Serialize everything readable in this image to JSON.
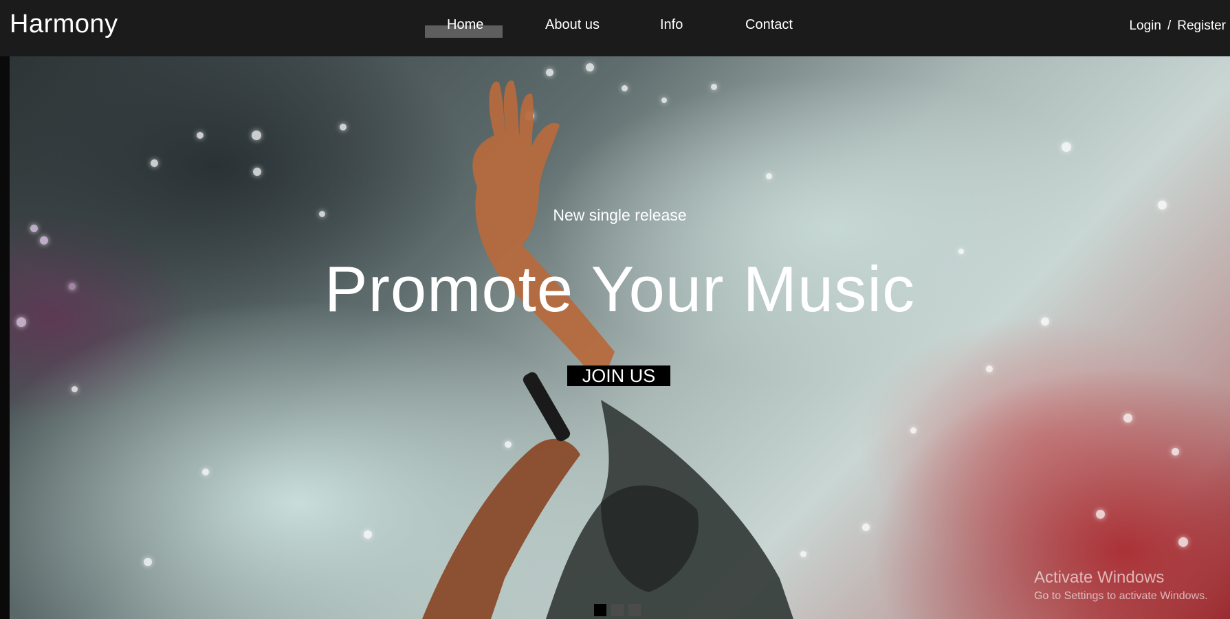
{
  "header": {
    "logo": "Harmony",
    "nav": {
      "items": [
        {
          "label": "Home",
          "active": true
        },
        {
          "label": "About us",
          "active": false
        },
        {
          "label": "Info",
          "active": false
        },
        {
          "label": "Contact",
          "active": false
        }
      ]
    },
    "auth": {
      "login": "Login",
      "separator": "/",
      "register": "Register"
    }
  },
  "hero": {
    "subtitle": "New single release",
    "headline": "Promote Your Music",
    "cta_label": "JOIN US",
    "slider": {
      "total": 3,
      "active_index": 0
    }
  },
  "os_overlay": {
    "title": "Activate Windows",
    "subtitle": "Go to Settings to activate Windows."
  },
  "colors": {
    "header_bg": "#1b1b1b",
    "nav_active_indicator": "#5e5e5e",
    "cta_bg": "#000000",
    "text": "#ffffff"
  }
}
